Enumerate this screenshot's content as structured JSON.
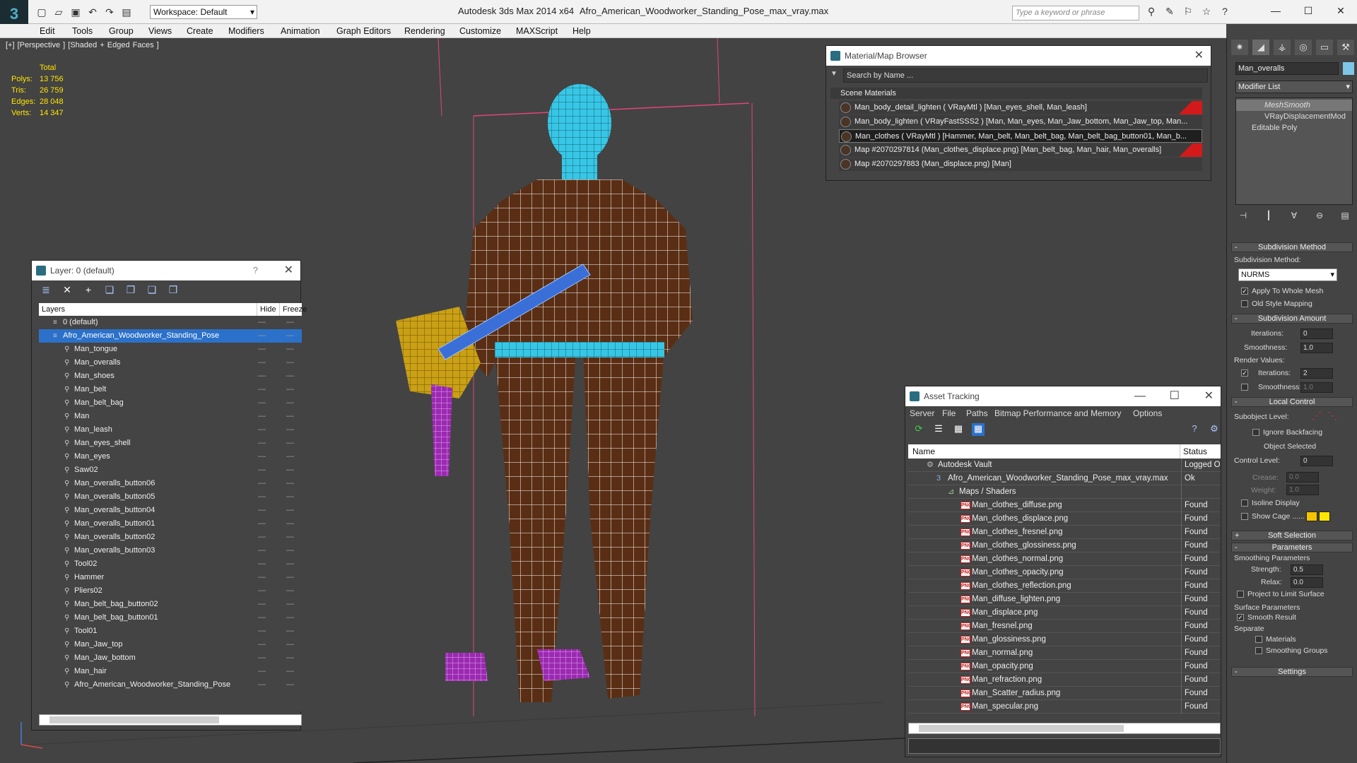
{
  "app": {
    "app_title": "Autodesk 3ds Max  2014 x64",
    "file_title": "Afro_American_Woodworker_Standing_Pose_max_vray.max",
    "workspace": "Workspace: Default",
    "search_placeholder": "Type a keyword or phrase"
  },
  "menu": [
    "Edit",
    "Tools",
    "Group",
    "Views",
    "Create",
    "Modifiers",
    "Animation",
    "Graph Editors",
    "Rendering",
    "Customize",
    "MAXScript",
    "Help"
  ],
  "viewport": {
    "label": "[+] [Perspective ] [Shaded + Edged Faces ]",
    "stats": {
      "total_label": "Total",
      "rows": [
        {
          "k": "Polys:",
          "v": "13 756"
        },
        {
          "k": "Tris:",
          "v": "26 759"
        },
        {
          "k": "Edges:",
          "v": "28 048"
        },
        {
          "k": "Verts:",
          "v": "14 347"
        }
      ]
    }
  },
  "layer_panel": {
    "title": "Layer: 0 (default)",
    "help": "?",
    "columns": {
      "layers": "Layers",
      "hide": "Hide",
      "freeze": "Freeze"
    },
    "layers": [
      {
        "name": "0 (default)",
        "top": true,
        "sel": false
      },
      {
        "name": "Afro_American_Woodworker_Standing_Pose",
        "top": true,
        "sel": true
      },
      {
        "name": "Man_tongue"
      },
      {
        "name": "Man_overalls"
      },
      {
        "name": "Man_shoes"
      },
      {
        "name": "Man_belt"
      },
      {
        "name": "Man_belt_bag"
      },
      {
        "name": "Man"
      },
      {
        "name": "Man_leash"
      },
      {
        "name": "Man_eyes_shell"
      },
      {
        "name": "Man_eyes"
      },
      {
        "name": "Saw02"
      },
      {
        "name": "Man_overalls_button06"
      },
      {
        "name": "Man_overalls_button05"
      },
      {
        "name": "Man_overalls_button04"
      },
      {
        "name": "Man_overalls_button01"
      },
      {
        "name": "Man_overalls_button02"
      },
      {
        "name": "Man_overalls_button03"
      },
      {
        "name": "Tool02"
      },
      {
        "name": "Hammer"
      },
      {
        "name": "Pliers02"
      },
      {
        "name": "Man_belt_bag_button02"
      },
      {
        "name": "Man_belt_bag_button01"
      },
      {
        "name": "Tool01"
      },
      {
        "name": "Man_Jaw_top"
      },
      {
        "name": "Man_Jaw_bottom"
      },
      {
        "name": "Man_hair"
      },
      {
        "name": "Afro_American_Woodworker_Standing_Pose"
      }
    ]
  },
  "material_browser": {
    "title": "Material/Map Browser",
    "search_placeholder": "Search by Name ...",
    "section": "Scene Materials",
    "rows": [
      {
        "text": "Man_body_detail_lighten  ( VRayMtl ) [Man_eyes_shell, Man_leash]",
        "red": true,
        "sel": false
      },
      {
        "text": "Man_body_lighten  ( VRayFastSSS2 ) [Man, Man_eyes, Man_Jaw_bottom, Man_Jaw_top, Man...",
        "red": false,
        "sel": false
      },
      {
        "text": "Man_clothes  ( VRayMtl ) [Hammer, Man_belt, Man_belt_bag, Man_belt_bag_button01, Man_b...",
        "red": false,
        "sel": true
      },
      {
        "text": "Map #2070297814 (Man_clothes_displace.png) [Man_belt_bag, Man_hair, Man_overalls]",
        "red": true,
        "sel": false
      },
      {
        "text": "Map #2070297883 (Man_displace.png) [Man]",
        "red": false,
        "sel": false
      }
    ]
  },
  "asset_tracking": {
    "title": "Asset Tracking",
    "menu": [
      "Server",
      "File",
      "Paths",
      "Bitmap Performance and Memory",
      "Options"
    ],
    "columns": {
      "name": "Name",
      "status": "Status"
    },
    "rows": [
      {
        "name": "Autodesk Vault",
        "status": "Logged Out",
        "level": 0,
        "kind": "vault"
      },
      {
        "name": "Afro_American_Woodworker_Standing_Pose_max_vray.max",
        "status": "Ok",
        "level": 1,
        "kind": "max"
      },
      {
        "name": "Maps / Shaders",
        "status": "",
        "level": 2,
        "kind": "folder"
      },
      {
        "name": "Man_clothes_diffuse.png",
        "status": "Found",
        "level": 3,
        "kind": "png"
      },
      {
        "name": "Man_clothes_displace.png",
        "status": "Found",
        "level": 3,
        "kind": "png"
      },
      {
        "name": "Man_clothes_fresnel.png",
        "status": "Found",
        "level": 3,
        "kind": "png"
      },
      {
        "name": "Man_clothes_glossiness.png",
        "status": "Found",
        "level": 3,
        "kind": "png"
      },
      {
        "name": "Man_clothes_normal.png",
        "status": "Found",
        "level": 3,
        "kind": "png"
      },
      {
        "name": "Man_clothes_opacity.png",
        "status": "Found",
        "level": 3,
        "kind": "png"
      },
      {
        "name": "Man_clothes_reflection.png",
        "status": "Found",
        "level": 3,
        "kind": "png"
      },
      {
        "name": "Man_diffuse_lighten.png",
        "status": "Found",
        "level": 3,
        "kind": "png"
      },
      {
        "name": "Man_displace.png",
        "status": "Found",
        "level": 3,
        "kind": "png"
      },
      {
        "name": "Man_fresnel.png",
        "status": "Found",
        "level": 3,
        "kind": "png"
      },
      {
        "name": "Man_glossiness.png",
        "status": "Found",
        "level": 3,
        "kind": "png"
      },
      {
        "name": "Man_normal.png",
        "status": "Found",
        "level": 3,
        "kind": "png"
      },
      {
        "name": "Man_opacity.png",
        "status": "Found",
        "level": 3,
        "kind": "png"
      },
      {
        "name": "Man_refraction.png",
        "status": "Found",
        "level": 3,
        "kind": "png"
      },
      {
        "name": "Man_Scatter_radius.png",
        "status": "Found",
        "level": 3,
        "kind": "png"
      },
      {
        "name": "Man_specular.png",
        "status": "Found",
        "level": 3,
        "kind": "png"
      }
    ]
  },
  "command_panel": {
    "object_name": "Man_overalls",
    "modifier_list": "Modifier List",
    "stack": [
      "MeshSmooth",
      "VRayDisplacementMod",
      "Editable Poly"
    ],
    "subdivision_method": {
      "title": "Subdivision Method",
      "label": "Subdivision Method:",
      "value": "NURMS",
      "apply_whole": "Apply To Whole Mesh",
      "old_style": "Old Style Mapping"
    },
    "subdivision_amount": {
      "title": "Subdivision Amount",
      "iterations_label": "Iterations:",
      "iterations": "0",
      "smoothness_label": "Smoothness:",
      "smoothness": "1.0",
      "render_values": "Render Values:",
      "r_iterations_label": "Iterations:",
      "r_iterations": "2",
      "r_smoothness_label": "Smoothness:",
      "r_smoothness": "1.0"
    },
    "local_control": {
      "title": "Local Control",
      "subobject_label": "Subobject Level:",
      "ignore_backfacing": "Ignore Backfacing",
      "object_selected": "Object Selected",
      "control_level_label": "Control Level:",
      "control_level": "0",
      "crease_label": "Crease:",
      "crease": "0.0",
      "weight_label": "Weight:",
      "weight": "1.0",
      "isoline": "Isoline Display",
      "show_cage": "Show Cage ......"
    },
    "soft_selection": "Soft Selection",
    "parameters": {
      "title": "Parameters",
      "smoothing_params": "Smoothing Parameters",
      "strength_label": "Strength:",
      "strength": "0.5",
      "relax_label": "Relax:",
      "relax": "0.0",
      "project_limit": "Project to Limit Surface",
      "surface_params": "Surface Parameters",
      "smooth_result": "Smooth Result",
      "separate": "Separate",
      "materials": "Materials",
      "smoothing_groups": "Smoothing Groups"
    },
    "settings": "Settings"
  },
  "colors": {
    "accent": "#2b71c9",
    "stats": "#ffe400",
    "wire": "#ffffff",
    "cloth": "#5a2e14",
    "head": "#37c7e6"
  }
}
